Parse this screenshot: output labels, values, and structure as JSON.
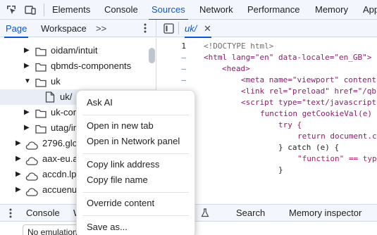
{
  "toolbar": {
    "tabs": [
      "Elements",
      "Console",
      "Sources",
      "Network",
      "Performance",
      "Memory",
      "App"
    ],
    "active_tab": "Sources"
  },
  "navigator": {
    "tabs": [
      "Page",
      "Workspace"
    ],
    "more": ">>",
    "active_tab": "Page"
  },
  "tree": {
    "items": [
      {
        "label": "oidam/intuit",
        "type": "folder"
      },
      {
        "label": "qbmds-components",
        "type": "folder"
      },
      {
        "label": "uk",
        "type": "folder",
        "expanded": true
      },
      {
        "label": "uk/",
        "type": "file",
        "selected": true
      },
      {
        "label": "uk-con",
        "type": "folder"
      },
      {
        "label": "utag/in",
        "type": "folder"
      },
      {
        "label": "2796.glo",
        "type": "cloud"
      },
      {
        "label": "aax-eu.a",
        "type": "cloud"
      },
      {
        "label": "accdn.lp",
        "type": "cloud"
      },
      {
        "label": "accuenu",
        "type": "cloud"
      }
    ]
  },
  "editor": {
    "file_tab": "uk/",
    "line_numbers": [
      "1",
      "–",
      "–",
      "–",
      "–",
      "–",
      "–",
      "–",
      "–",
      "–",
      "–"
    ],
    "lines": [
      "<!DOCTYPE html>",
      "<html lang=\"en\" data-locale=\"en_GB\">",
      "<head>",
      "<meta name=\"viewport\" content",
      "<link rel=\"preload\" href=\"/qb",
      "<script type=\"text/javascript",
      "function getCookieVal(e)",
      "try {",
      "return document.c",
      "} catch (e) {",
      "\"function\" == typ",
      "}"
    ]
  },
  "bottom": {
    "tabs": [
      "Console",
      "W",
      "Search",
      "Memory inspector"
    ],
    "emulation_value": "No emulation"
  },
  "context_menu": {
    "groups": [
      [
        "Ask AI"
      ],
      [
        "Open in new tab",
        "Open in Network panel"
      ],
      [
        "Copy link address",
        "Copy file name"
      ],
      [
        "Override content"
      ],
      [
        "Save as..."
      ]
    ]
  },
  "colors": {
    "accent": "#0b57d0",
    "toolbar_bg": "#f3f6fc",
    "selection_bg": "#e9eef6"
  }
}
